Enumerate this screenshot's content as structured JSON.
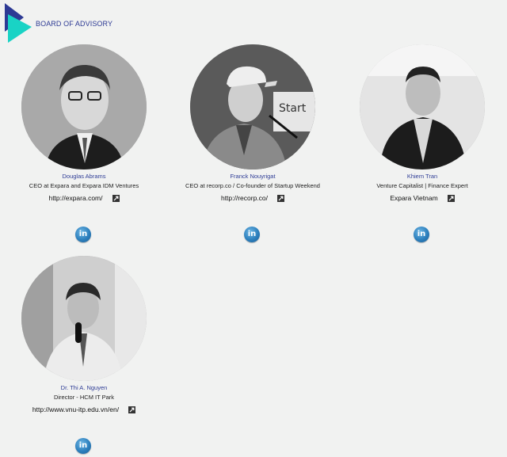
{
  "section": {
    "title": "BOARD OF ADVISORY",
    "brand_colors": {
      "triangle_back": "#2d3a94",
      "triangle_front": "#19d3c5"
    }
  },
  "advisors": [
    {
      "name": "Douglas Abrams",
      "role": "CEO at Expara and Expara IDM Ventures",
      "link": "http://expara.com/",
      "social": "in"
    },
    {
      "name": "Franck Nouyrigat",
      "role": "CEO at recorp.co / Co-founder of Startup Weekend",
      "link": "http://recorp.co/",
      "social": "in"
    },
    {
      "name": "Khiem Tran",
      "role": "Venture Capitalist | Finance Expert",
      "link": "Expara Vietnam",
      "social": "in"
    },
    {
      "name": "Dr. Thi A. Nguyen",
      "role": "Director - HCM IT Park",
      "link": "http://www.vnu-itp.edu.vn/en/",
      "social": "in"
    }
  ],
  "icons": {
    "external_link": "external-link-icon",
    "linkedin": "linkedin-icon"
  }
}
